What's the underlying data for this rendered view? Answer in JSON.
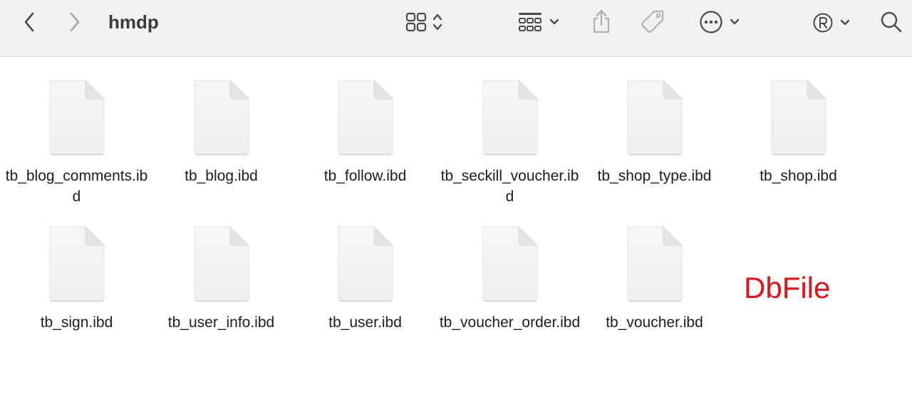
{
  "window": {
    "title": "hmdp"
  },
  "toolbar": {
    "back_icon": "chevron-left-icon",
    "forward_icon": "chevron-right-icon",
    "view_mode_icon": "icon-grid-view-icon",
    "group_icon": "group-by-icon",
    "share_icon": "share-icon",
    "tag_icon": "tag-icon",
    "more_icon": "more-actions-icon",
    "extension_icon": "registered-icon",
    "search_icon": "search-icon"
  },
  "files": [
    {
      "name": "tb_blog_comments.ibd"
    },
    {
      "name": "tb_blog.ibd"
    },
    {
      "name": "tb_follow.ibd"
    },
    {
      "name": "tb_seckill_voucher.ibd"
    },
    {
      "name": "tb_shop_type.ibd"
    },
    {
      "name": "tb_shop.ibd"
    },
    {
      "name": "tb_sign.ibd"
    },
    {
      "name": "tb_user_info.ibd"
    },
    {
      "name": "tb_user.ibd"
    },
    {
      "name": "tb_voucher_order.ibd"
    },
    {
      "name": "tb_voucher.ibd"
    }
  ],
  "annotation": {
    "text": "DbFile",
    "color": "#e8101a"
  }
}
